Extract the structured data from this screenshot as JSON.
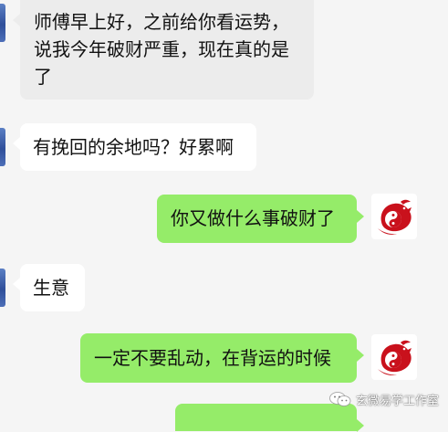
{
  "messages": [
    {
      "side": "in",
      "lines": [
        "师傅早上好，之前给你看运势，",
        "说我今年破财严重，现在真的是",
        "了"
      ]
    },
    {
      "side": "in",
      "lines": [
        "有挽回的余地吗？好累啊"
      ]
    },
    {
      "side": "out",
      "lines": [
        "你又做什么事破财了"
      ]
    },
    {
      "side": "in",
      "lines": [
        "生意"
      ]
    },
    {
      "side": "out",
      "lines": [
        "一定不要乱动，在背运的时候"
      ]
    }
  ],
  "watermark": {
    "text": "玄微易学工作室",
    "icon": "wechat-icon"
  },
  "colors": {
    "background": "#f5f5f5",
    "incoming_bubble": "#ffffff",
    "outgoing_bubble": "#95ec69",
    "avatar_red": "#c9111c"
  }
}
